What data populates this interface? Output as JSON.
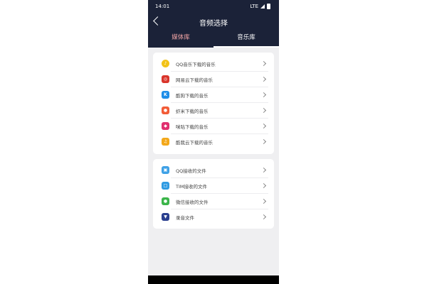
{
  "status": {
    "time": "14:01",
    "network": "LTE"
  },
  "header": {
    "title": "音频选择"
  },
  "tabs": [
    {
      "label": "媒体库"
    },
    {
      "label": "音乐库"
    }
  ],
  "group1": [
    {
      "label": "QQ音乐下载的音乐",
      "icon": "qq-music-icon",
      "color": "#f2c318"
    },
    {
      "label": "网易云下载的音乐",
      "icon": "netease-music-icon",
      "color": "#d9352b"
    },
    {
      "label": "酷狗下载的音乐",
      "icon": "kugou-icon",
      "color": "#1f8ee8"
    },
    {
      "label": "虾米下载的音乐",
      "icon": "xiami-icon",
      "color": "#f25c37"
    },
    {
      "label": "咪咕下载的音乐",
      "icon": "migu-icon",
      "color": "#e0306f"
    },
    {
      "label": "酷我云下载的音乐",
      "icon": "kuwo-icon",
      "color": "#f3a81b"
    }
  ],
  "group2": [
    {
      "label": "QQ接收的文件",
      "icon": "qq-file-icon",
      "color": "#3fa1e6"
    },
    {
      "label": "TIM接收的文件",
      "icon": "tim-file-icon",
      "color": "#2f9be2"
    },
    {
      "label": "微信接收的文件",
      "icon": "wechat-file-icon",
      "color": "#3bb54a"
    },
    {
      "label": "录音文件",
      "icon": "recording-icon",
      "color": "#2a3f8f"
    }
  ]
}
